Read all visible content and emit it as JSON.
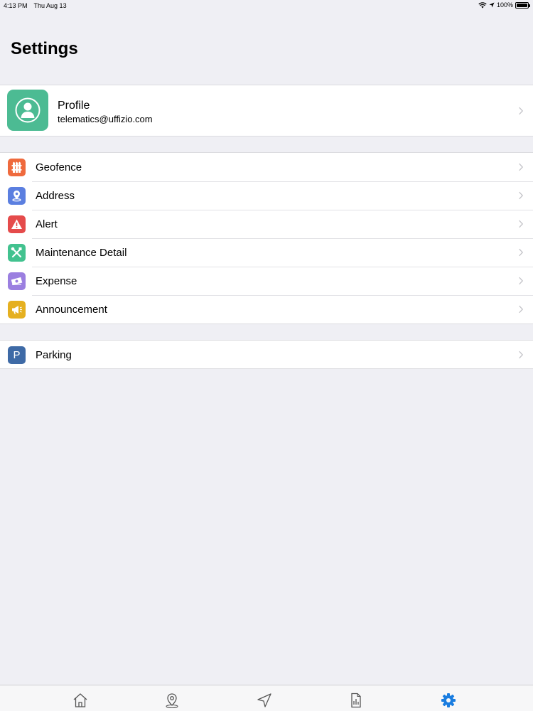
{
  "status_bar": {
    "time": "4:13 PM",
    "date": "Thu Aug 13",
    "battery": "100%"
  },
  "page": {
    "title": "Settings"
  },
  "profile": {
    "name": "Profile",
    "email": "telematics@uffizio.com",
    "icon": "person-icon",
    "color": "#4cbb93"
  },
  "menu": {
    "items": [
      {
        "label": "Geofence",
        "icon": "fence-icon",
        "color": "#ef6a3d"
      },
      {
        "label": "Address",
        "icon": "location-pin-icon",
        "color": "#5b7fe0"
      },
      {
        "label": "Alert",
        "icon": "warning-icon",
        "color": "#e54b4b"
      },
      {
        "label": "Maintenance Detail",
        "icon": "tools-icon",
        "color": "#42c28f"
      },
      {
        "label": "Expense",
        "icon": "money-icon",
        "color": "#9b7fe0"
      },
      {
        "label": "Announcement",
        "icon": "megaphone-icon",
        "color": "#e5b020"
      }
    ],
    "parking": {
      "label": "Parking",
      "icon": "parking-icon",
      "icon_text": "P",
      "color": "#3e6aa6"
    }
  },
  "tabs": [
    {
      "name": "home",
      "icon": "home-icon"
    },
    {
      "name": "map",
      "icon": "map-pin-icon"
    },
    {
      "name": "navigate",
      "icon": "navigation-arrow-icon"
    },
    {
      "name": "reports",
      "icon": "report-icon"
    },
    {
      "name": "settings",
      "icon": "gear-icon",
      "active": true
    }
  ],
  "colors": {
    "active_tab": "#1a7de0",
    "inactive_tab": "#555555",
    "background": "#efeff4"
  }
}
